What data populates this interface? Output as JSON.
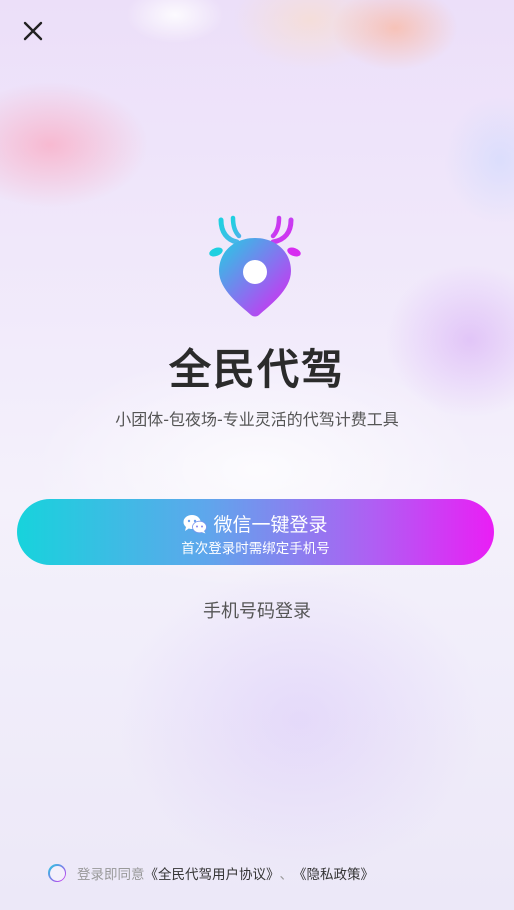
{
  "app": {
    "name": "全民代驾",
    "slogan": "小团体-包夜场-专业灵活的代驾计费工具"
  },
  "buttons": {
    "wechat_login": "微信一键登录",
    "wechat_login_sub": "首次登录时需绑定手机号",
    "phone_login": "手机号码登录"
  },
  "agreement": {
    "prefix": "登录即同意",
    "user_agreement": "《全民代驾用户协议》",
    "separator": "、",
    "privacy_policy": "《隐私政策》"
  },
  "icons": {
    "close": "close-icon",
    "wechat": "wechat-icon",
    "logo": "deer-location-pin-logo"
  },
  "colors": {
    "gradient_start": "#17d3dc",
    "gradient_end": "#ea1ef5",
    "title": "#2b2b2b"
  }
}
